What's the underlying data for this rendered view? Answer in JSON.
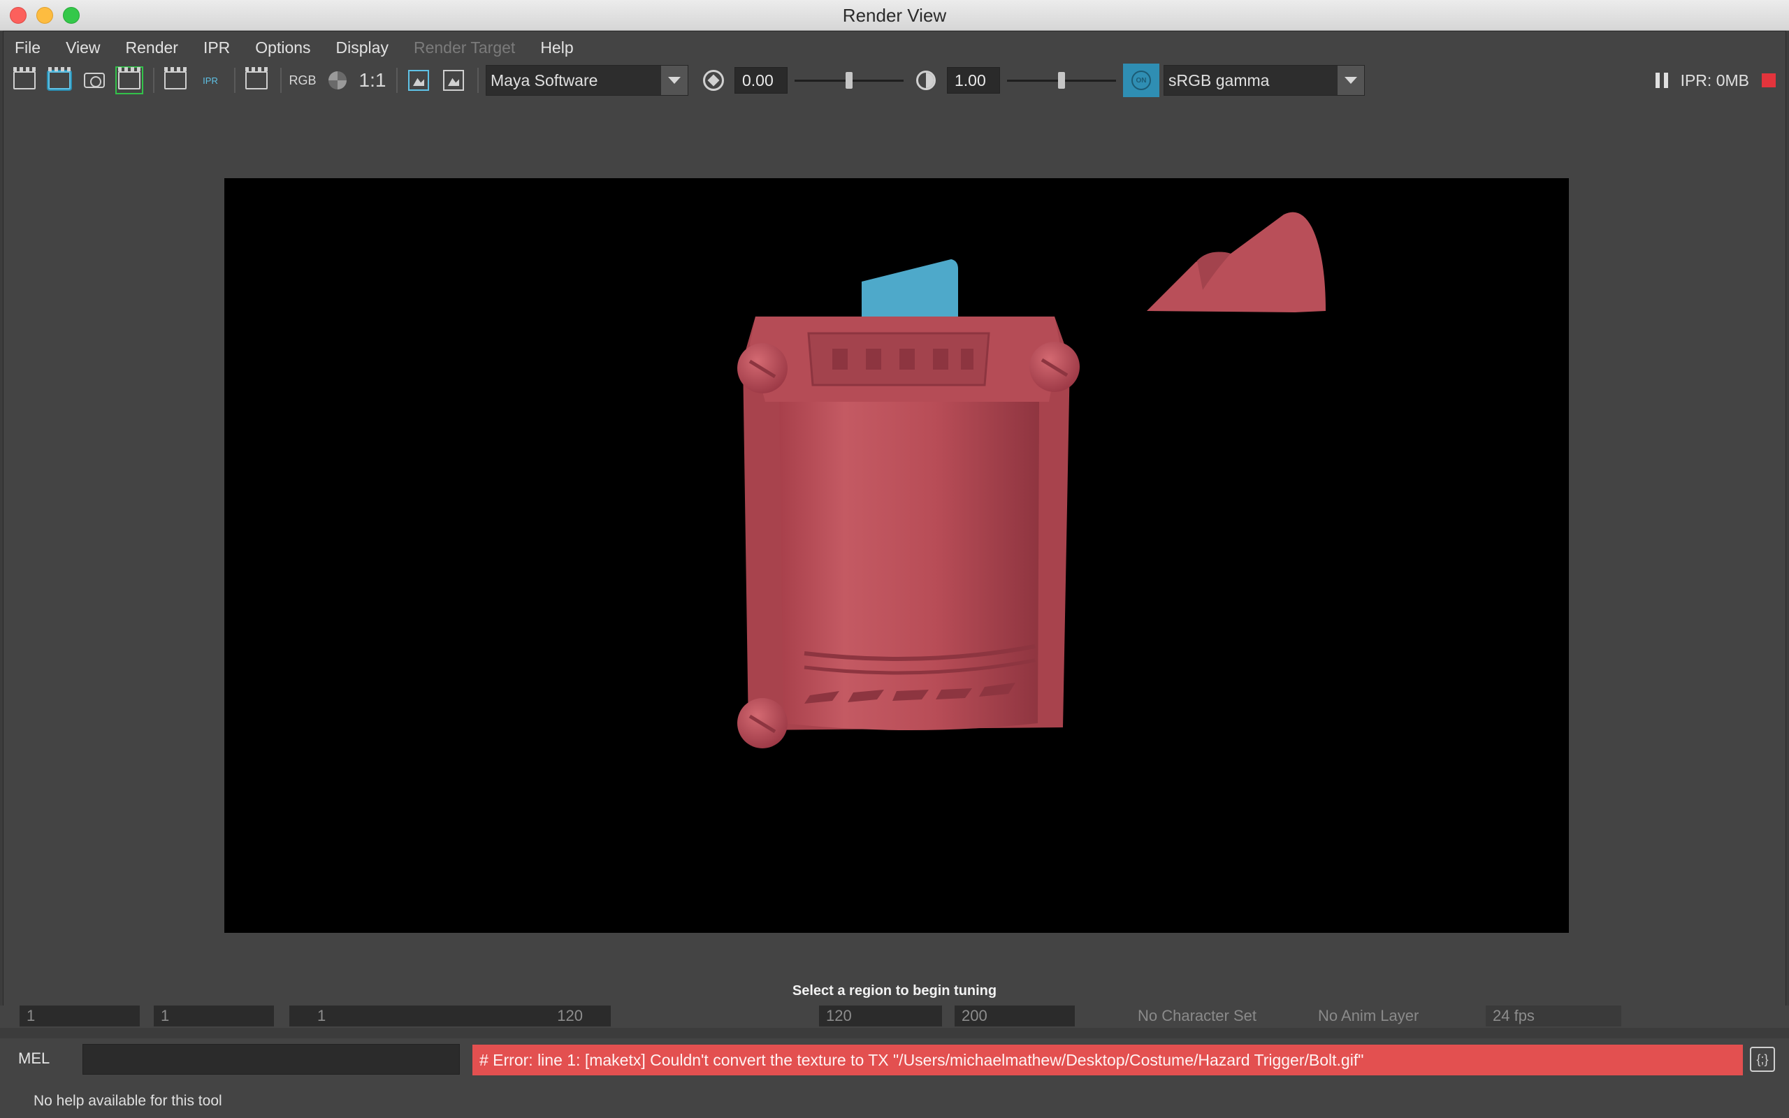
{
  "window": {
    "title": "Render View"
  },
  "menu": [
    "File",
    "View",
    "Render",
    "IPR",
    "Options",
    "Display",
    "Render Target",
    "Help"
  ],
  "toolbar": {
    "rgb_label": "RGB",
    "ratio_label": "1:1",
    "renderer": "Maya Software",
    "exposure": "0.00",
    "gamma": "1.00",
    "colorspace": "sRGB gamma",
    "toggle_label": "ON",
    "ipr_memory": "IPR: 0MB",
    "ipr_small": "IPR",
    "exposure_level": 0.5,
    "gamma_level": 0.5
  },
  "render": {
    "hint": "Select a region to begin tuning",
    "colors": {
      "prop_red": "#b84a54",
      "card_blue": "#4aa7c8"
    }
  },
  "timeline": {
    "start": "1",
    "playback_start": "1",
    "range_start": "1",
    "range_end": "120",
    "playback_end": "120",
    "end": "200",
    "character_set": "No Character Set",
    "anim_layer": "No Anim Layer",
    "fps": "24 fps"
  },
  "command_line": {
    "language": "MEL",
    "output": "# Error: line 1: [maketx] Couldn't convert the texture to TX \"/Users/michaelmathew/Desktop/Costume/Hazard Trigger/Bolt.gif\"",
    "error_color": "#e35050"
  },
  "help_line": {
    "text": "No help available for this tool"
  }
}
